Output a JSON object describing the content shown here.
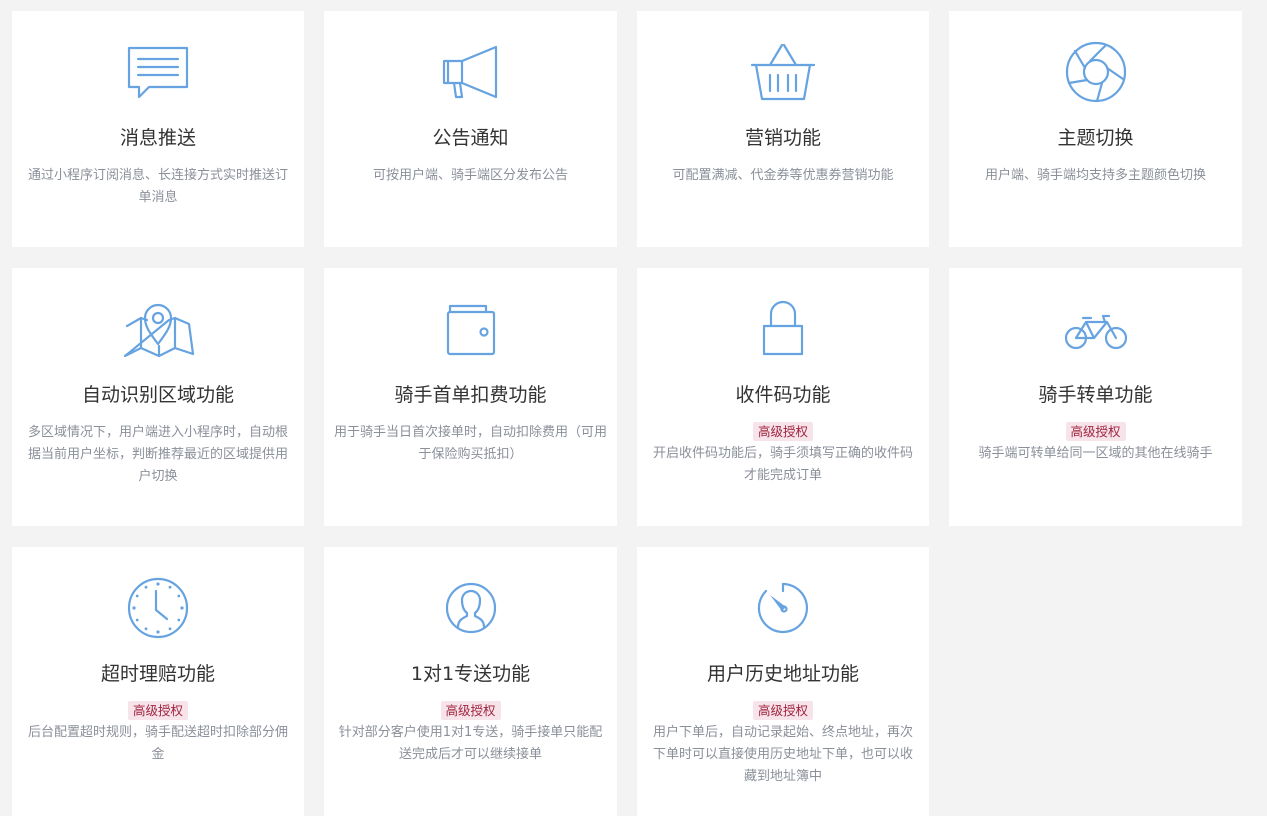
{
  "accent_color": "#66a3e0",
  "badge_color": "#a0233f",
  "cards": [
    {
      "title": "消息推送",
      "icon": "message-icon",
      "badge": "",
      "desc": "通过小程序订阅消息、长连接方式实时推送订单消息"
    },
    {
      "title": "公告通知",
      "icon": "megaphone-icon",
      "badge": "",
      "desc": "可按用户端、骑手端区分发布公告"
    },
    {
      "title": "营销功能",
      "icon": "basket-icon",
      "badge": "",
      "desc": "可配置满减、代金券等优惠券营销功能"
    },
    {
      "title": "主题切换",
      "icon": "aperture-icon",
      "badge": "",
      "desc": "用户端、骑手端均支持多主题颜色切换"
    },
    {
      "title": "自动识别区域功能",
      "icon": "map-pin-icon",
      "badge": "",
      "desc": "多区域情况下，用户端进入小程序时，自动根据当前用户坐标，判断推荐最近的区域提供用户切换"
    },
    {
      "title": "骑手首单扣费功能",
      "icon": "wallet-icon",
      "badge": "",
      "desc": "用于骑手当日首次接单时，自动扣除费用（可用于保险购买抵扣）"
    },
    {
      "title": "收件码功能",
      "icon": "lock-icon",
      "badge": "高级授权",
      "desc": "开启收件码功能后，骑手须填写正确的收件码才能完成订单"
    },
    {
      "title": "骑手转单功能",
      "icon": "bicycle-icon",
      "badge": "高级授权",
      "desc": "骑手端可转单给同一区域的其他在线骑手"
    },
    {
      "title": "超时理赔功能",
      "icon": "clock-icon",
      "badge": "高级授权",
      "desc": "后台配置超时规则，骑手配送超时扣除部分佣金"
    },
    {
      "title": "1对1专送功能",
      "icon": "user-icon",
      "badge": "高级授权",
      "desc": "针对部分客户使用1对1专送，骑手接单只能配送完成后才可以继续接单"
    },
    {
      "title": "用户历史地址功能",
      "icon": "timer-icon",
      "badge": "高级授权",
      "desc": "用户下单后，自动记录起始、终点地址，再次下单时可以直接使用历史地址下单，也可以收藏到地址簿中"
    }
  ]
}
